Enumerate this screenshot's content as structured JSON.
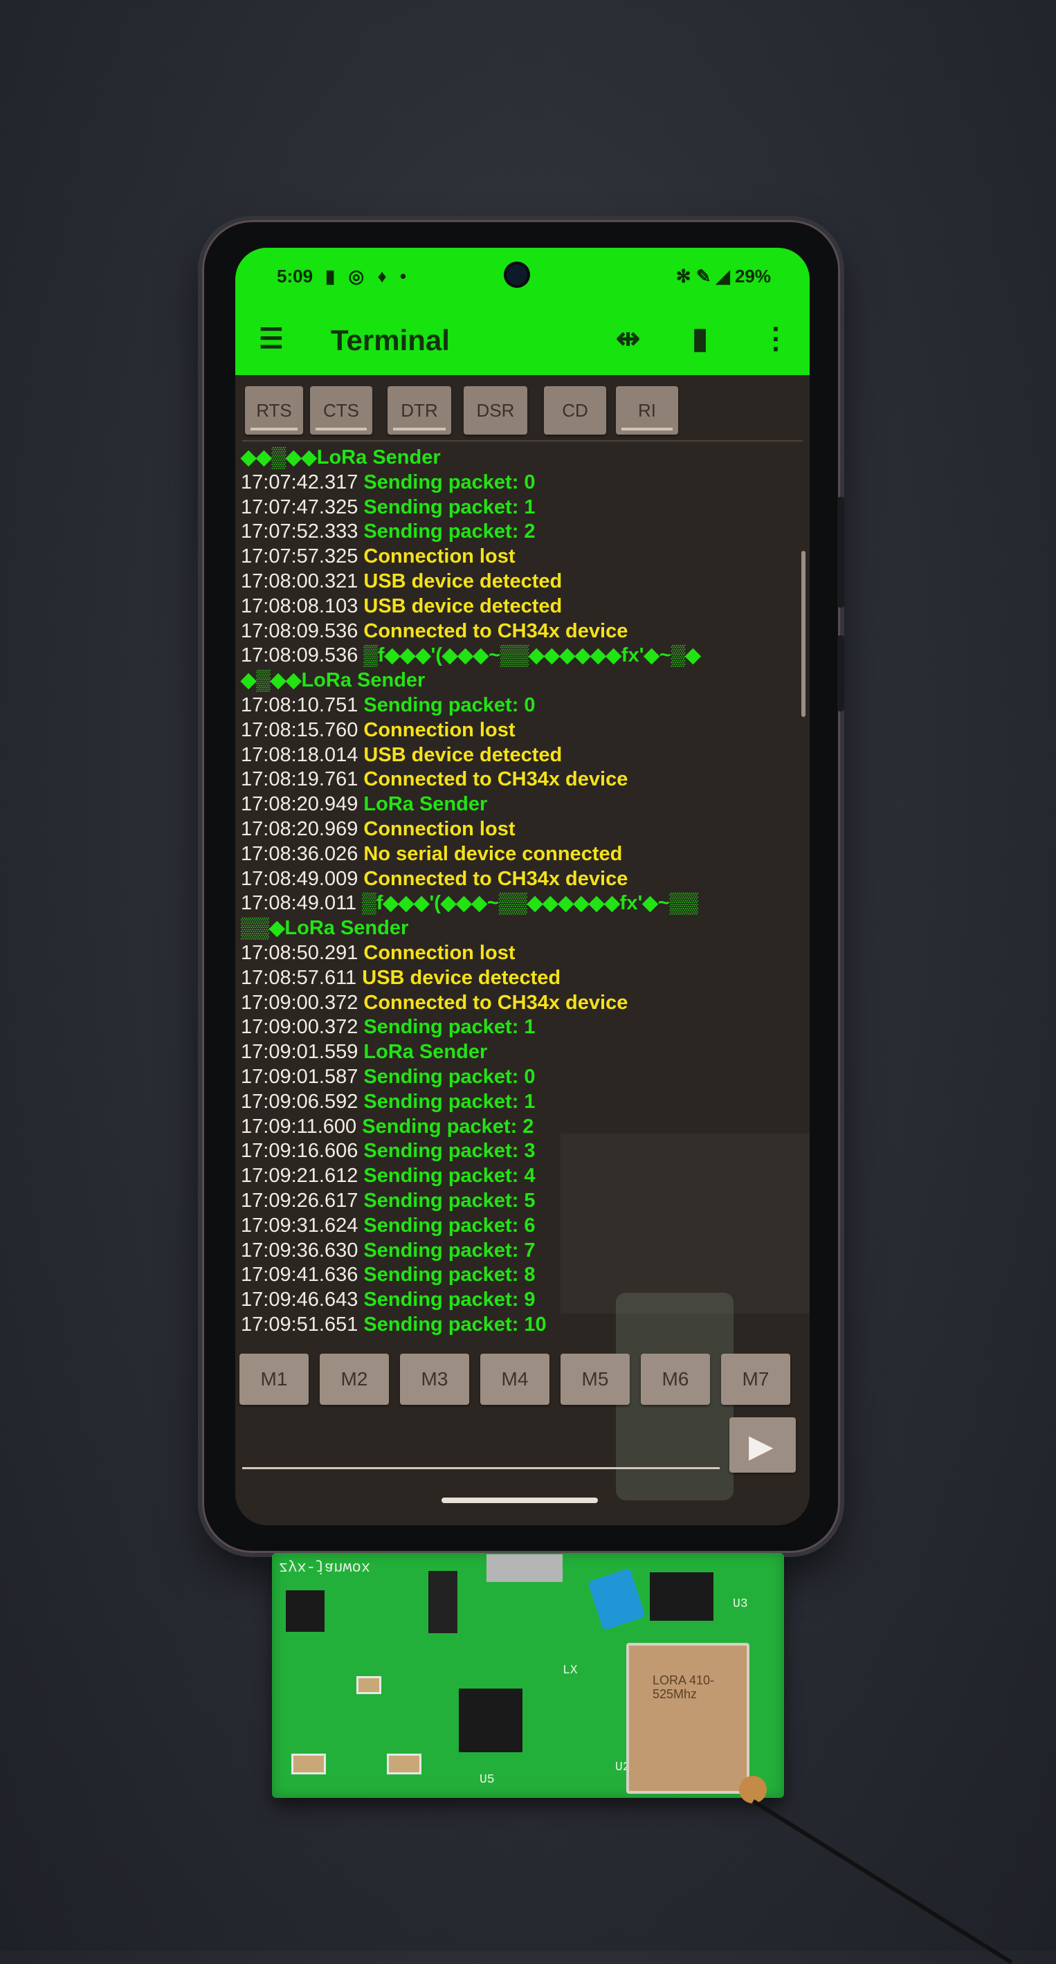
{
  "statusbar": {
    "time": "5:09",
    "icons": "▮ ◎ ♦ •",
    "right": "✻ ✎ ◢ 29%"
  },
  "appbar": {
    "menu_icon": "menu-icon",
    "title": "Terminal",
    "usb_icon": "usb-icon",
    "trash_icon": "trash-icon",
    "more_icon": "more-vert-icon"
  },
  "controls": [
    "RTS",
    "CTS",
    "DTR",
    "DSR",
    "CD",
    "RI"
  ],
  "terminal": [
    {
      "ts": "",
      "text": "◆◆▒◆◆LoRa Sender",
      "color": "g"
    },
    {
      "ts": "17:07:42.317",
      "text": "Sending packet: 0",
      "color": "g"
    },
    {
      "ts": "17:07:47.325",
      "text": "Sending packet: 1",
      "color": "g"
    },
    {
      "ts": "17:07:52.333",
      "text": "Sending packet: 2",
      "color": "g"
    },
    {
      "ts": "17:07:57.325",
      "text": "Connection lost",
      "color": "y"
    },
    {
      "ts": "17:08:00.321",
      "text": "USB device detected",
      "color": "y"
    },
    {
      "ts": "17:08:08.103",
      "text": "USB device detected",
      "color": "y"
    },
    {
      "ts": "17:08:09.536",
      "text": "Connected to CH34x device",
      "color": "y"
    },
    {
      "ts": "17:08:09.536",
      "text": "▒f◆◆◆'(◆◆◆~▒▒◆◆◆◆◆◆fx'◆~▒◆",
      "color": "g"
    },
    {
      "ts": "",
      "text": "◆▒◆◆LoRa Sender",
      "color": "g"
    },
    {
      "ts": "17:08:10.751",
      "text": "Sending packet: 0",
      "color": "g"
    },
    {
      "ts": "17:08:15.760",
      "text": "Connection lost",
      "color": "y"
    },
    {
      "ts": "17:08:18.014",
      "text": "USB device detected",
      "color": "y"
    },
    {
      "ts": "17:08:19.761",
      "text": "Connected to CH34x device",
      "color": "y"
    },
    {
      "ts": "17:08:20.949",
      "text": "LoRa Sender",
      "color": "g"
    },
    {
      "ts": "17:08:20.969",
      "text": "Connection lost",
      "color": "y"
    },
    {
      "ts": "17:08:36.026",
      "text": "No serial device connected",
      "color": "y"
    },
    {
      "ts": "17:08:49.009",
      "text": "Connected to CH34x device",
      "color": "y"
    },
    {
      "ts": "17:08:49.011",
      "text": "▒f◆◆◆'(◆◆◆~▒▒◆◆◆◆◆◆fx'◆~▒▒",
      "color": "g"
    },
    {
      "ts": "",
      "text": "▒▒◆LoRa Sender",
      "color": "g"
    },
    {
      "ts": "17:08:50.291",
      "text": "Connection lost",
      "color": "y"
    },
    {
      "ts": "17:08:57.611",
      "text": "USB device detected",
      "color": "y"
    },
    {
      "ts": "17:09:00.372",
      "text": "Connected to CH34x device",
      "color": "y"
    },
    {
      "ts": "17:09:00.372",
      "text": "Sending packet: 1",
      "color": "g"
    },
    {
      "ts": "17:09:01.559",
      "text": "LoRa Sender",
      "color": "g"
    },
    {
      "ts": "17:09:01.587",
      "text": "Sending packet: 0",
      "color": "g"
    },
    {
      "ts": "17:09:06.592",
      "text": "Sending packet: 1",
      "color": "g"
    },
    {
      "ts": "17:09:11.600",
      "text": "Sending packet: 2",
      "color": "g"
    },
    {
      "ts": "17:09:16.606",
      "text": "Sending packet: 3",
      "color": "g"
    },
    {
      "ts": "17:09:21.612",
      "text": "Sending packet: 4",
      "color": "g"
    },
    {
      "ts": "17:09:26.617",
      "text": "Sending packet: 5",
      "color": "g"
    },
    {
      "ts": "17:09:31.624",
      "text": "Sending packet: 6",
      "color": "g"
    },
    {
      "ts": "17:09:36.630",
      "text": "Sending packet: 7",
      "color": "g"
    },
    {
      "ts": "17:09:41.636",
      "text": "Sending packet: 8",
      "color": "g"
    },
    {
      "ts": "17:09:46.643",
      "text": "Sending packet: 9",
      "color": "g"
    },
    {
      "ts": "17:09:51.651",
      "text": "Sending packet: 10",
      "color": "g"
    }
  ],
  "macros": [
    "M1",
    "M2",
    "M3",
    "M4",
    "M5",
    "M6",
    "M7"
  ],
  "send_icon": "send-icon",
  "pcb": {
    "silkscreen": "zyx-janwox",
    "labels": [
      "U5",
      "U3",
      "LX",
      "U2"
    ],
    "module_text": "LORA 410-525Mhz"
  }
}
